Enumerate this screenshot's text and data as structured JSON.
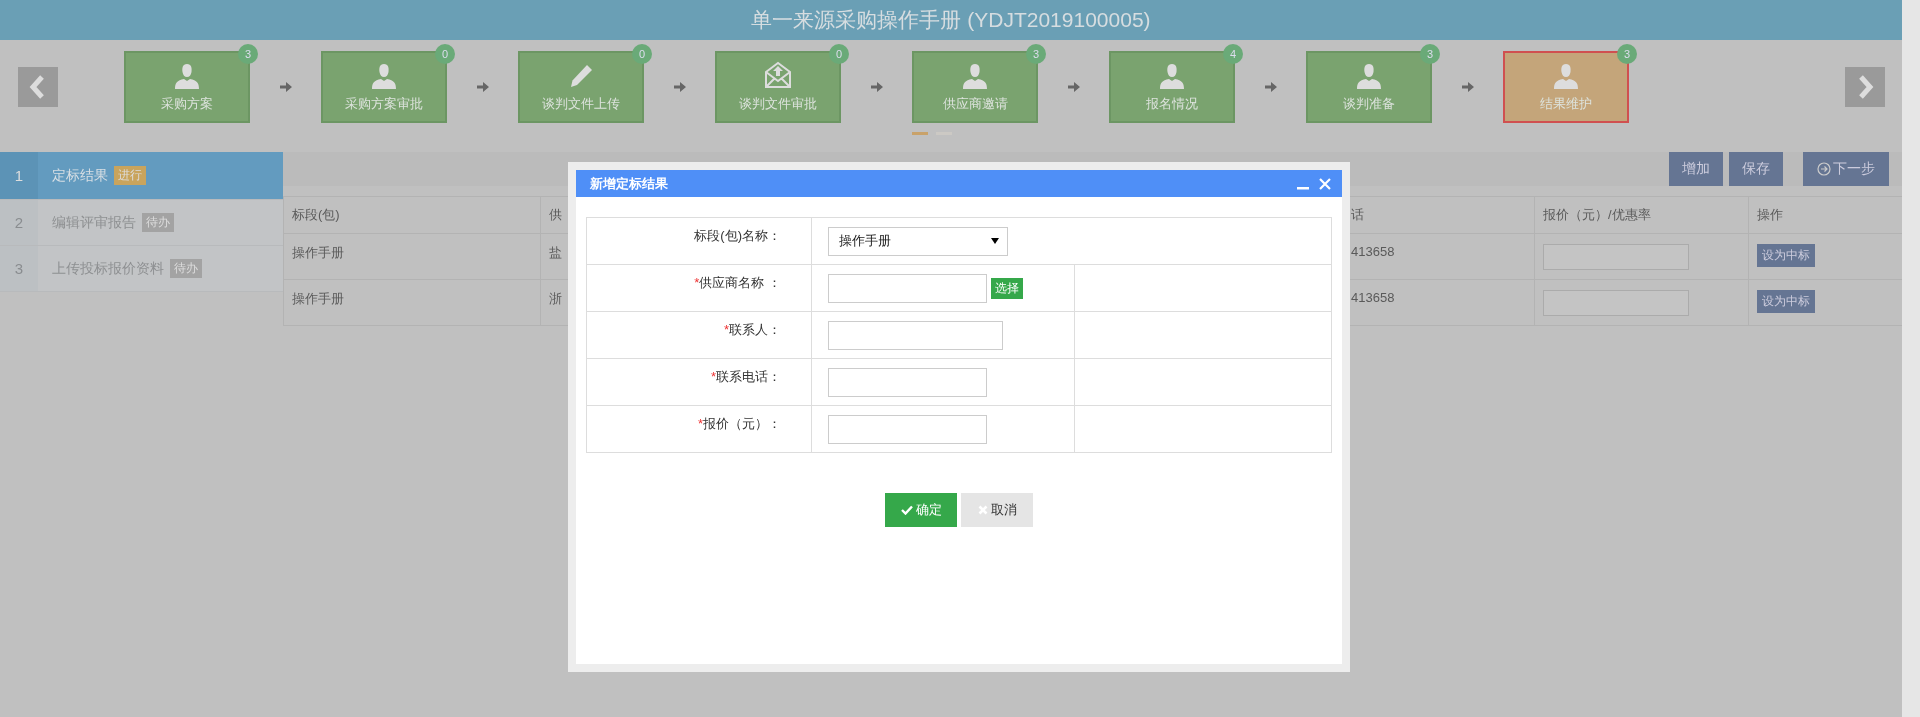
{
  "title": "单一来源采购操作手册 (YDJT2019100005)",
  "steps": [
    {
      "label": "采购方案",
      "count": "3",
      "kind": "person",
      "selected": false
    },
    {
      "label": "采购方案审批",
      "count": "0",
      "kind": "person",
      "selected": false
    },
    {
      "label": "谈判文件上传",
      "count": "0",
      "kind": "pencil",
      "selected": false
    },
    {
      "label": "谈判文件审批",
      "count": "0",
      "kind": "mail",
      "selected": false
    },
    {
      "label": "供应商邀请",
      "count": "3",
      "kind": "person",
      "selected": false
    },
    {
      "label": "报名情况",
      "count": "4",
      "kind": "person",
      "selected": false
    },
    {
      "label": "谈判准备",
      "count": "3",
      "kind": "person",
      "selected": false
    },
    {
      "label": "结果维护",
      "count": "3",
      "kind": "person",
      "selected": true
    }
  ],
  "pager": [
    {
      "selected": true
    },
    {
      "selected": false
    }
  ],
  "sidebar": {
    "items": [
      {
        "number": "1",
        "label": "定标结果",
        "badge": "进行",
        "selected": true
      },
      {
        "number": "2",
        "label": "编辑评审报告",
        "badge": "待办",
        "selected": false
      },
      {
        "number": "3",
        "label": "上传投标报价资料",
        "badge": "待办",
        "selected": false
      }
    ]
  },
  "toolbar": {
    "buttons": [
      {
        "label": "增加",
        "kind": "plain"
      },
      {
        "label": "保存",
        "kind": "plain"
      },
      {
        "label": "下一步",
        "kind": "next"
      }
    ]
  },
  "table": {
    "columns": [
      "标段(包)",
      "供",
      "话",
      "报价（元）/优惠率",
      "操作"
    ],
    "rows": [
      {
        "cells": [
          "操作手册",
          "盐",
          "413658"
        ],
        "action": "设为中标"
      },
      {
        "cells": [
          "操作手册",
          "浙",
          "413658"
        ],
        "action": "设为中标"
      }
    ]
  },
  "dialog": {
    "title": "新增定标结果",
    "fields": [
      {
        "label": "标段(包)名称：",
        "kind": "select",
        "value": "操作手册"
      },
      {
        "label": "供应商名称 ：",
        "required_mark": "*",
        "kind": "picker",
        "button": "选择"
      },
      {
        "label": "联系人：",
        "required_mark": "*",
        "kind": "text"
      },
      {
        "label": "联系电话：",
        "required_mark": "*",
        "kind": "text"
      },
      {
        "label": "报价（元）：",
        "required_mark": "*",
        "kind": "text"
      }
    ],
    "buttons": [
      {
        "label": "确定",
        "kind": "primary"
      },
      {
        "label": "取消",
        "kind": "secondary"
      }
    ]
  }
}
